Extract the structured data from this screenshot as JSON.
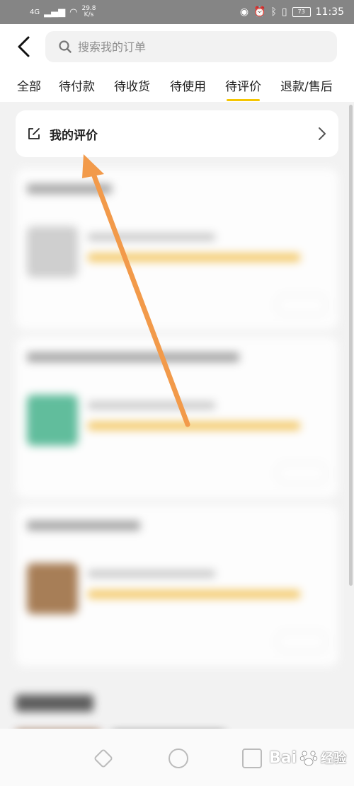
{
  "status_bar": {
    "signal": "4G",
    "net_speed_value": "29.8",
    "net_speed_unit": "K/s",
    "battery": "73",
    "time": "11:35"
  },
  "header": {
    "search_placeholder": "搜索我的订单"
  },
  "tabs": [
    {
      "label": "全部",
      "active": false
    },
    {
      "label": "待付款",
      "active": false
    },
    {
      "label": "待收货",
      "active": false
    },
    {
      "label": "待使用",
      "active": false
    },
    {
      "label": "待评价",
      "active": true
    },
    {
      "label": "退款/售后",
      "active": false
    }
  ],
  "review_card": {
    "title": "我的评价"
  },
  "colors": {
    "accent": "#f5c500",
    "annotation_arrow": "#f29a4a"
  },
  "watermark": {
    "brand": "Bai",
    "brand_suffix": "经验"
  }
}
